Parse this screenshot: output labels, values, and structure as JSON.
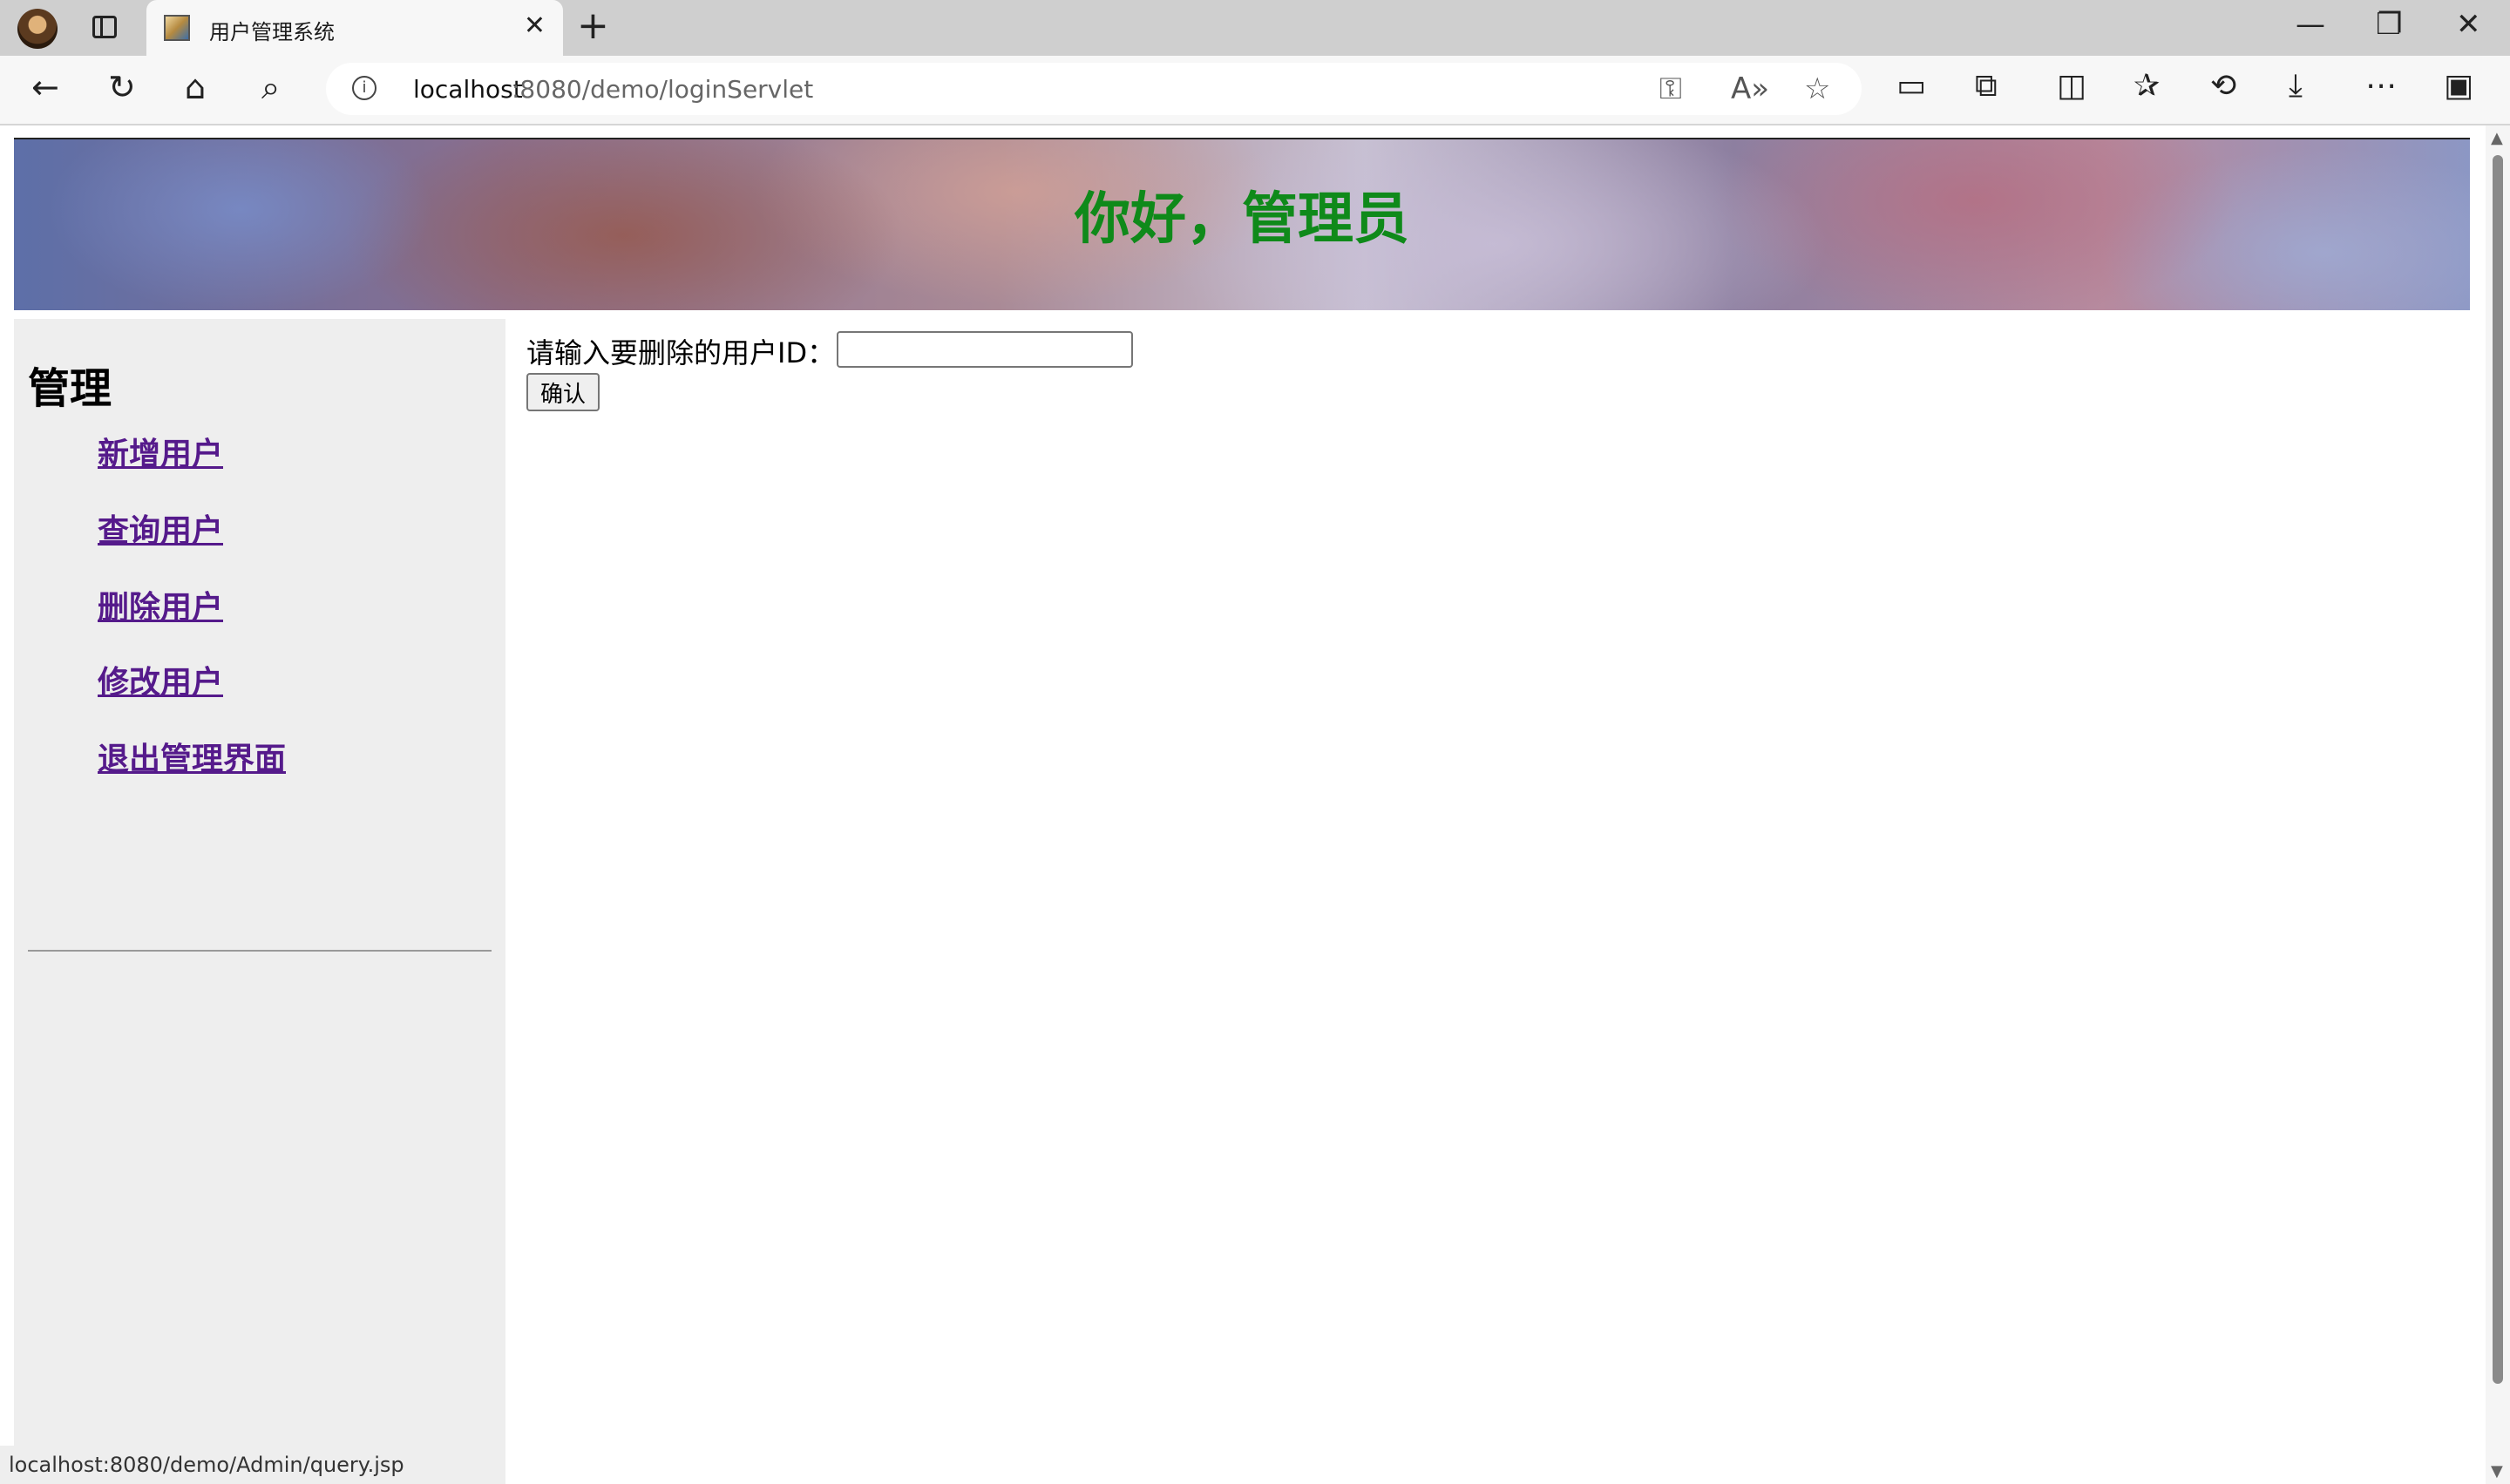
{
  "browser": {
    "tab_title": "用户管理系统",
    "url_host": "localhost",
    "url_path": ":8080/demo/loginServlet",
    "status_url": "localhost:8080/demo/Admin/query.jsp"
  },
  "icons": {
    "back": "←",
    "refresh": "↻",
    "home": "⌂",
    "search": "⌕",
    "info": "i",
    "key": "⚿",
    "read_aloud": "A»",
    "favorite": "☆",
    "close": "✕",
    "new_tab": "+",
    "minimize": "—",
    "restore": "❐",
    "window_close": "✕",
    "extensions": "⧉",
    "split": "◫",
    "favorites": "✰",
    "history": "⟲",
    "download": "⤓",
    "more": "⋯",
    "sidebar": "▣",
    "coupon": "▭"
  },
  "header": {
    "greeting": "你好，管理员"
  },
  "sidebar": {
    "title": "管理",
    "items": [
      {
        "label": "新增用户"
      },
      {
        "label": "查询用户"
      },
      {
        "label": "删除用户"
      },
      {
        "label": "修改用户"
      },
      {
        "label": "退出管理界面"
      }
    ]
  },
  "form": {
    "prompt": "请输入要删除的用户ID：",
    "input_value": "",
    "submit_label": "确认"
  },
  "colors": {
    "greeting": "#0f8a1a",
    "visited_link": "#551a8b",
    "sidebar_bg": "#eeeeee"
  }
}
